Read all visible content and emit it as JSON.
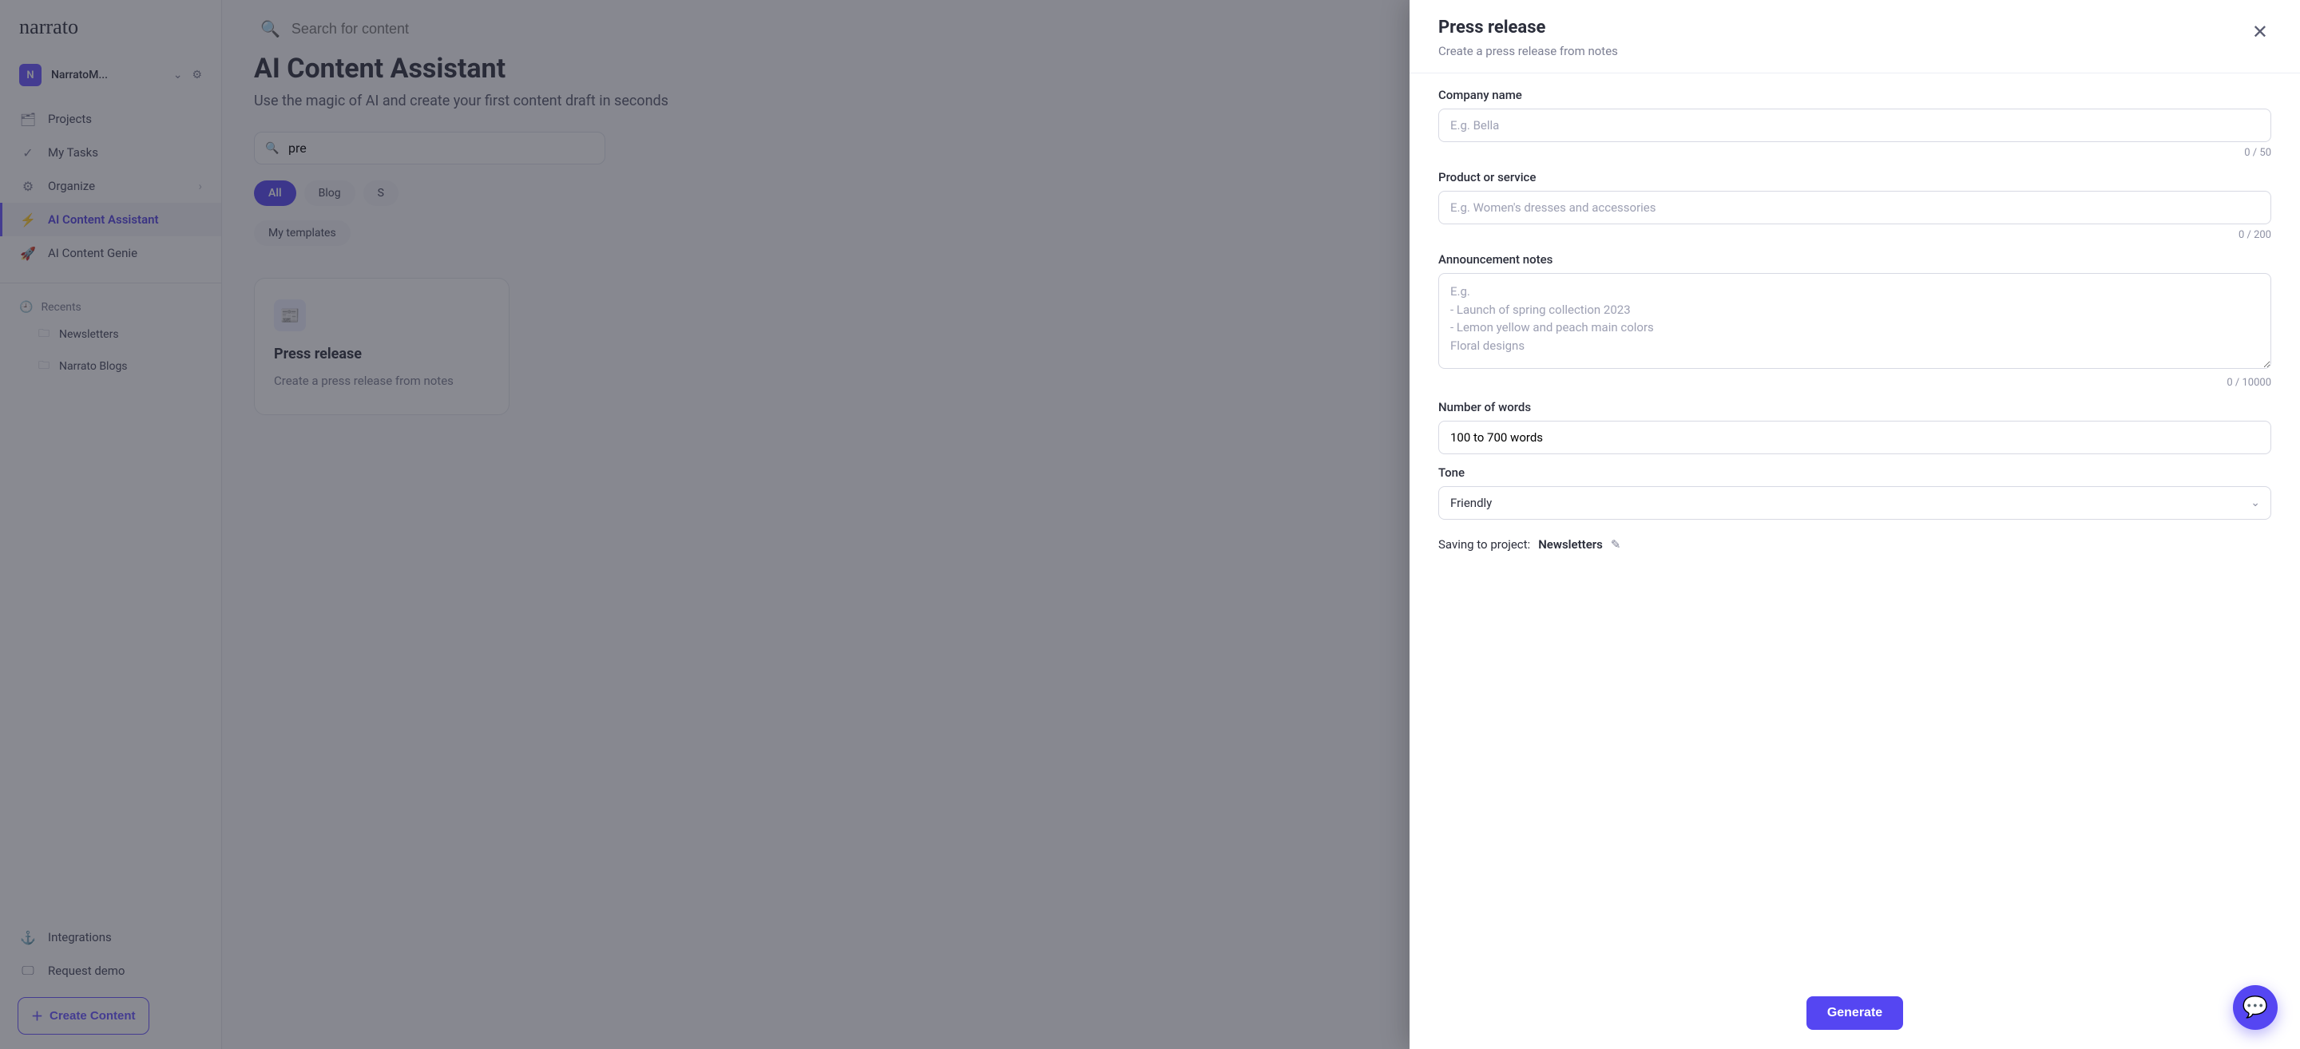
{
  "brand": {
    "alt": "narrato"
  },
  "workspace": {
    "initial": "N",
    "name": "NarratoM..."
  },
  "search_top_placeholder": "Search for content",
  "nav": {
    "projects": "Projects",
    "my_tasks": "My Tasks",
    "organize": "Organize",
    "ai_assistant": "AI Content Assistant",
    "ai_genie": "AI Content Genie"
  },
  "recents": {
    "heading": "Recents",
    "items": [
      "Newsletters",
      "Narrato Blogs"
    ]
  },
  "bottom_nav": {
    "integrations": "Integrations",
    "request_demo": "Request demo",
    "create_content": "Create Content"
  },
  "page": {
    "title": "AI Content Assistant",
    "subtitle": "Use the magic of AI and create your first content draft in seconds"
  },
  "filter_search_value": "pre",
  "tabs": {
    "all": "All",
    "blog": "Blog",
    "s": "S",
    "my_templates": "My templates"
  },
  "card": {
    "title": "Press release",
    "desc": "Create a press release from notes"
  },
  "modal": {
    "title": "Press release",
    "subtitle": "Create a press release from notes",
    "company_label": "Company name",
    "company_placeholder": "E.g. Bella",
    "company_counter": "0 / 50",
    "product_label": "Product or service",
    "product_placeholder": "E.g. Women's dresses and accessories",
    "product_counter": "0 / 200",
    "notes_label": "Announcement notes",
    "notes_placeholder": "E.g.\n- Launch of spring collection 2023\n- Lemon yellow and peach main colors\nFloral designs",
    "notes_counter": "0 / 10000",
    "words_label": "Number of words",
    "words_value": "100 to 700 words",
    "tone_label": "Tone",
    "tone_value": "Friendly",
    "saving_label": "Saving to project:",
    "project_name": "Newsletters",
    "generate": "Generate"
  }
}
